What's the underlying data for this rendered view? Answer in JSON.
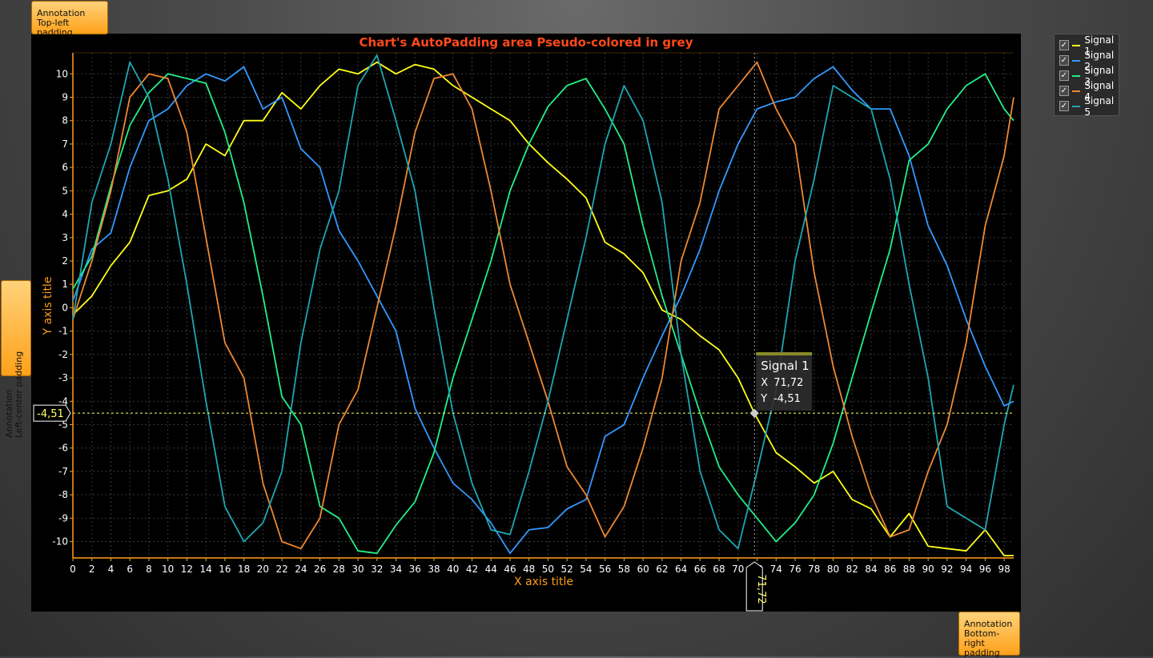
{
  "annotations": {
    "top_left": [
      "Annotation",
      "Top-left padding"
    ],
    "left_center": [
      "Annotation",
      "Left-center padding"
    ],
    "bottom_right": [
      "Annotation",
      "Bottom-right",
      "padding"
    ]
  },
  "cursor": {
    "series": "Signal 1",
    "x_label": "X",
    "x_value": "71,72",
    "y_label": "Y",
    "y_value": "-4,51"
  },
  "colors": {
    "title": "#ff4a1a",
    "axis": "#ff9d1a",
    "cursor": "#ffff66"
  },
  "chart_data": {
    "type": "line",
    "title": "Chart's AutoPadding area Pseudo-colored in grey",
    "xlabel": "X axis title",
    "ylabel": "Y axis title",
    "xlim": [
      0,
      99
    ],
    "ylim": [
      -10.7,
      10.9
    ],
    "xticks": [
      "0",
      "2",
      "4",
      "6",
      "8",
      "10",
      "12",
      "14",
      "16",
      "18",
      "20",
      "22",
      "24",
      "26",
      "28",
      "30",
      "32",
      "34",
      "36",
      "38",
      "40",
      "42",
      "44",
      "46",
      "48",
      "50",
      "52",
      "54",
      "56",
      "58",
      "60",
      "62",
      "64",
      "66",
      "68",
      "70",
      "72",
      "74",
      "76",
      "78",
      "80",
      "82",
      "84",
      "86",
      "88",
      "90",
      "92",
      "94",
      "96",
      "98"
    ],
    "yticks": [
      "-10",
      "-9",
      "-8",
      "-7",
      "-6",
      "-5",
      "-4",
      "-3",
      "-2",
      "-1",
      "0",
      "1",
      "2",
      "3",
      "4",
      "5",
      "6",
      "7",
      "8",
      "9",
      "10"
    ],
    "grid": true,
    "legend_position": "right",
    "series": [
      {
        "name": "Signal 1",
        "color": "#ffff1a",
        "x": [
          0,
          2,
          4,
          6,
          8,
          10,
          12,
          14,
          16,
          18,
          20,
          22,
          24,
          26,
          28,
          30,
          32,
          34,
          36,
          38,
          40,
          42,
          44,
          46,
          48,
          50,
          52,
          54,
          56,
          58,
          60,
          62,
          64,
          66,
          68,
          70,
          71.72,
          74,
          76,
          78,
          80,
          82,
          84,
          86,
          88,
          90,
          92,
          94,
          96,
          98,
          99
        ],
        "y": [
          -0.3,
          0.5,
          1.8,
          2.8,
          4.8,
          5.0,
          5.5,
          7.0,
          6.5,
          8.0,
          8.0,
          9.2,
          8.5,
          9.5,
          10.2,
          10.0,
          10.5,
          10.0,
          10.4,
          10.2,
          9.5,
          9.0,
          8.5,
          8.0,
          7.0,
          6.2,
          5.5,
          4.7,
          2.8,
          2.3,
          1.5,
          -0.1,
          -0.5,
          -1.2,
          -1.8,
          -3.0,
          -4.51,
          -6.2,
          -6.8,
          -7.5,
          -7.0,
          -8.2,
          -8.6,
          -9.8,
          -8.8,
          -10.2,
          -10.3,
          -10.4,
          -9.5,
          -10.6,
          -10.6
        ]
      },
      {
        "name": "Signal 2",
        "color": "#3399ff",
        "x": [
          0,
          2,
          4,
          6,
          8,
          10,
          12,
          14,
          16,
          18,
          20,
          22,
          24,
          26,
          28,
          30,
          32,
          34,
          36,
          38,
          40,
          42,
          44,
          46,
          48,
          50,
          52,
          54,
          56,
          58,
          60,
          62,
          64,
          66,
          68,
          70,
          72,
          74,
          76,
          78,
          80,
          82,
          84,
          86,
          88,
          90,
          92,
          94,
          96,
          98,
          99
        ],
        "y": [
          0.3,
          2.5,
          3.2,
          6.0,
          8.0,
          8.5,
          9.5,
          10.0,
          9.7,
          10.3,
          8.5,
          9.0,
          6.8,
          6.0,
          3.3,
          2.0,
          0.5,
          -1.0,
          -4.3,
          -6.0,
          -7.5,
          -8.2,
          -9.2,
          -10.5,
          -9.5,
          -9.4,
          -8.6,
          -8.2,
          -5.5,
          -5.0,
          -3.0,
          -1.2,
          0.5,
          2.5,
          5.0,
          7.0,
          8.5,
          8.8,
          9.0,
          9.8,
          10.3,
          9.3,
          8.5,
          8.5,
          6.5,
          3.5,
          1.8,
          -0.5,
          -2.5,
          -4.2,
          -4.0
        ]
      },
      {
        "name": "Signal 3",
        "color": "#22ee88",
        "x": [
          0,
          2,
          4,
          6,
          8,
          10,
          12,
          14,
          16,
          18,
          20,
          22,
          24,
          26,
          28,
          30,
          32,
          34,
          36,
          38,
          40,
          42,
          44,
          46,
          48,
          50,
          52,
          54,
          56,
          58,
          60,
          62,
          64,
          66,
          68,
          70,
          72,
          74,
          76,
          78,
          80,
          82,
          84,
          86,
          88,
          90,
          92,
          94,
          96,
          98,
          99
        ],
        "y": [
          0.8,
          2.2,
          5.2,
          7.8,
          9.2,
          10.0,
          9.8,
          9.6,
          7.5,
          4.5,
          0.5,
          -3.8,
          -5.0,
          -8.5,
          -9.0,
          -10.4,
          -10.5,
          -9.3,
          -8.3,
          -6.2,
          -3.0,
          -0.5,
          2.0,
          5.0,
          7.0,
          8.6,
          9.5,
          9.8,
          8.5,
          7.0,
          3.5,
          0.5,
          -2.0,
          -4.5,
          -6.8,
          -8.0,
          -9.0,
          -10.0,
          -9.2,
          -8.0,
          -5.8,
          -3.0,
          -0.2,
          2.5,
          6.3,
          7.0,
          8.5,
          9.5,
          10.0,
          8.5,
          8.0
        ]
      },
      {
        "name": "Signal 4",
        "color": "#ee8833",
        "x": [
          0,
          2,
          4,
          6,
          8,
          10,
          12,
          14,
          16,
          18,
          20,
          22,
          24,
          26,
          28,
          30,
          32,
          34,
          36,
          38,
          40,
          42,
          44,
          46,
          48,
          50,
          52,
          54,
          56,
          58,
          60,
          62,
          64,
          66,
          68,
          70,
          72,
          74,
          76,
          78,
          80,
          82,
          84,
          86,
          88,
          90,
          92,
          94,
          96,
          98,
          99
        ],
        "y": [
          -0.5,
          2.0,
          5.0,
          9.0,
          10.0,
          9.8,
          7.5,
          3.0,
          -1.5,
          -3.0,
          -7.5,
          -10.0,
          -10.3,
          -9.0,
          -5.0,
          -3.5,
          0.0,
          3.5,
          7.5,
          9.8,
          10.0,
          8.5,
          5.0,
          1.0,
          -1.5,
          -4.0,
          -6.8,
          -8.0,
          -9.8,
          -8.5,
          -6.0,
          -3.0,
          2.0,
          4.5,
          8.5,
          9.5,
          10.5,
          8.5,
          7.0,
          1.5,
          -2.5,
          -5.5,
          -8.0,
          -9.8,
          -9.5,
          -7.0,
          -5.0,
          -1.5,
          3.5,
          6.5,
          9.0
        ]
      },
      {
        "name": "Signal 5",
        "color": "#1fa6b0",
        "x": [
          0,
          2,
          4,
          6,
          8,
          10,
          12,
          14,
          16,
          18,
          20,
          22,
          24,
          26,
          28,
          30,
          32,
          34,
          36,
          38,
          40,
          42,
          44,
          46,
          48,
          50,
          52,
          54,
          56,
          58,
          60,
          62,
          64,
          66,
          68,
          70,
          72,
          74,
          76,
          78,
          80,
          82,
          84,
          86,
          88,
          90,
          92,
          94,
          96,
          98,
          99
        ],
        "y": [
          -0.5,
          4.5,
          7.0,
          10.5,
          9.0,
          5.5,
          1.0,
          -4.0,
          -8.5,
          -10.0,
          -9.2,
          -7.0,
          -1.5,
          2.5,
          5.0,
          9.5,
          10.8,
          8.0,
          5.0,
          0.0,
          -4.5,
          -7.5,
          -9.5,
          -9.7,
          -7.0,
          -4.0,
          -0.5,
          3.0,
          7.0,
          9.5,
          8.0,
          4.5,
          -2.0,
          -7.0,
          -9.5,
          -10.3,
          -7.0,
          -3.5,
          2.0,
          5.5,
          9.5,
          9.0,
          8.5,
          5.5,
          1.0,
          -3.0,
          -8.5,
          -9.0,
          -9.5,
          -5.0,
          -3.3
        ]
      }
    ]
  }
}
